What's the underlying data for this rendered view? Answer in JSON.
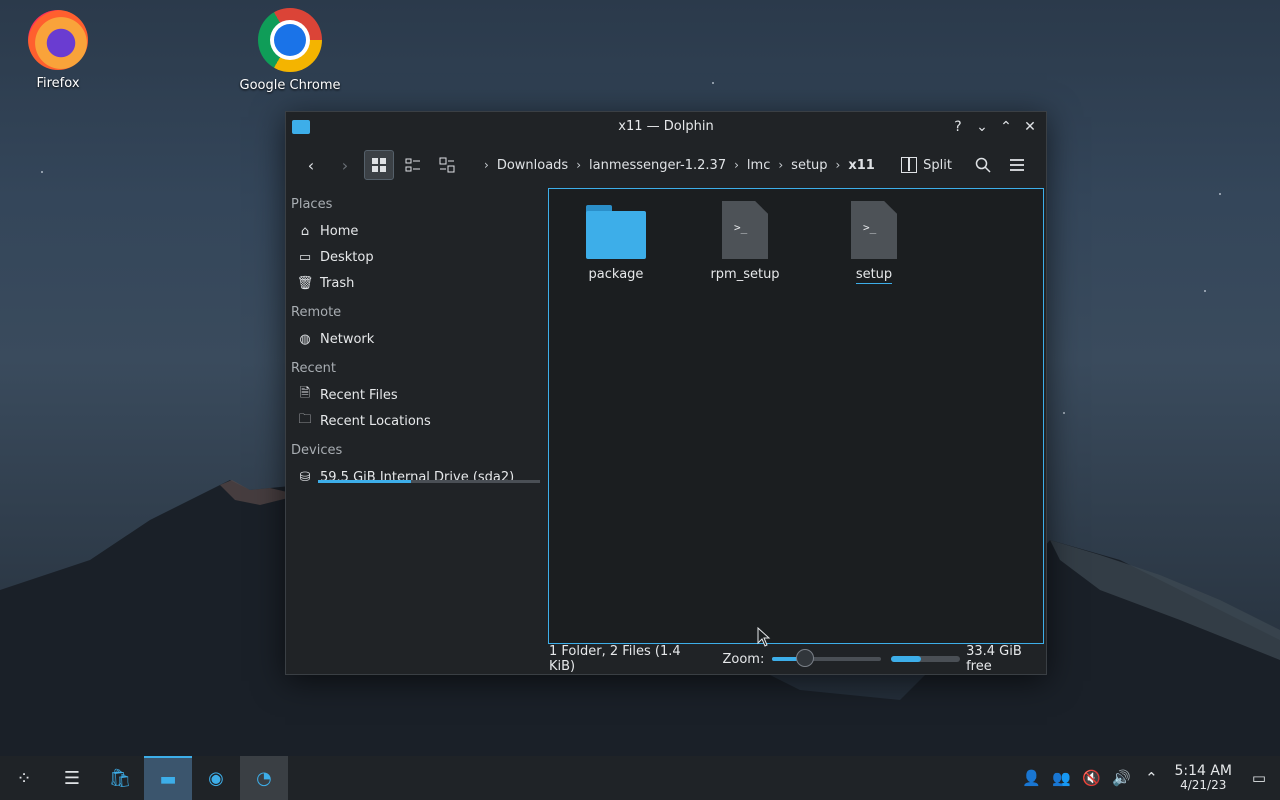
{
  "desktop": {
    "icons": [
      {
        "label": "Firefox",
        "icon": "firefox-icon"
      },
      {
        "label": "Google Chrome",
        "icon": "chrome-icon"
      }
    ]
  },
  "window": {
    "title": "x11 — Dolphin",
    "controls": [
      "help-icon",
      "minimize-icon",
      "maximize-icon",
      "close-icon"
    ]
  },
  "toolbar": {
    "breadcrumbs": [
      "Downloads",
      "lanmessenger-1.2.37",
      "lmc",
      "setup",
      "x11"
    ],
    "split_label": "Split"
  },
  "sidebar": {
    "places_header": "Places",
    "places": [
      {
        "label": "Home",
        "icon": "home-icon"
      },
      {
        "label": "Desktop",
        "icon": "desktop-icon"
      },
      {
        "label": "Trash",
        "icon": "trash-icon"
      }
    ],
    "remote_header": "Remote",
    "remote": [
      {
        "label": "Network",
        "icon": "network-icon"
      }
    ],
    "recent_header": "Recent",
    "recent": [
      {
        "label": "Recent Files",
        "icon": "recent-files-icon"
      },
      {
        "label": "Recent Locations",
        "icon": "recent-locations-icon"
      }
    ],
    "devices_header": "Devices",
    "devices": [
      {
        "label": "59.5 GiB Internal Drive (sda2)",
        "icon": "drive-icon",
        "usage_fraction": 0.42
      }
    ]
  },
  "files": [
    {
      "name": "package",
      "type": "folder"
    },
    {
      "name": "rpm_setup",
      "type": "script"
    },
    {
      "name": "setup",
      "type": "script",
      "selected": true
    }
  ],
  "status": {
    "summary": "1 Folder, 2 Files (1.4 KiB)",
    "zoom_label": "Zoom:",
    "zoom_fraction": 0.28,
    "free_fraction": 0.44,
    "free_label": "33.4 GiB free"
  },
  "taskbar": {
    "clock_time": "5:14 AM",
    "clock_date": "4/21/23"
  },
  "colors": {
    "accent": "#3daee9",
    "window_bg": "#202326",
    "view_bg": "#1b1e20"
  }
}
